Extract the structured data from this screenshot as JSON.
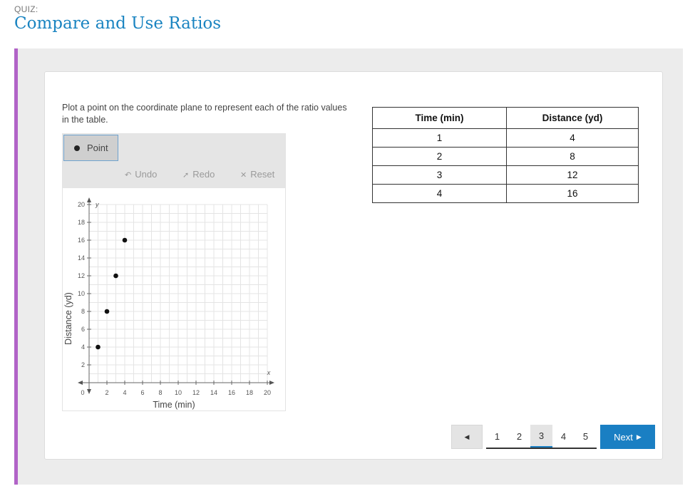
{
  "header": {
    "quiz_label": "QUIZ:",
    "title": "Compare and Use Ratios"
  },
  "question": {
    "prompt": "Plot a point on the coordinate plane to represent each of the ratio values in the table."
  },
  "toolbar": {
    "point_label": "Point",
    "undo_label": "Undo",
    "redo_label": "Redo",
    "reset_label": "Reset"
  },
  "table": {
    "headers": [
      "Time (min)",
      "Distance (yd)"
    ],
    "rows": [
      [
        "1",
        "4"
      ],
      [
        "2",
        "8"
      ],
      [
        "3",
        "12"
      ],
      [
        "4",
        "16"
      ]
    ]
  },
  "chart_data": {
    "type": "scatter",
    "xlabel": "Time (min)",
    "ylabel": "Distance (yd)",
    "x_axis_letter": "x",
    "y_axis_letter": "y",
    "xlim": [
      0,
      20
    ],
    "ylim": [
      0,
      20
    ],
    "x_ticks": [
      "0",
      "2",
      "4",
      "6",
      "8",
      "10",
      "12",
      "14",
      "16",
      "18",
      "20"
    ],
    "y_ticks": [
      "2",
      "4",
      "6",
      "8",
      "10",
      "12",
      "14",
      "16",
      "18",
      "20"
    ],
    "grid": true,
    "points": [
      {
        "x": 1,
        "y": 4
      },
      {
        "x": 2,
        "y": 8
      },
      {
        "x": 3,
        "y": 12
      },
      {
        "x": 4,
        "y": 16
      }
    ]
  },
  "pagination": {
    "pages": [
      "1",
      "2",
      "3",
      "4",
      "5"
    ],
    "current": "3",
    "next_label": "Next"
  },
  "colors": {
    "accent": "#1a7fc3",
    "title": "#1a84c1",
    "sidebar": "#b163c7"
  }
}
